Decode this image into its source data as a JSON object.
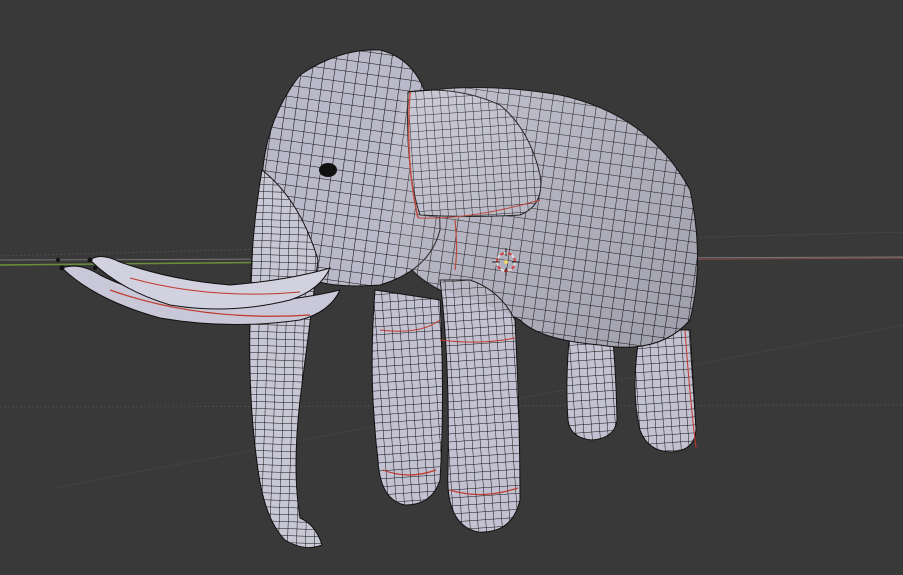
{
  "viewport": {
    "background": "#393939",
    "grid_line_color": "#4a4a4a",
    "mode": "edit-mode-wireframe-overlay",
    "shading": "solid"
  },
  "model": {
    "object": "elephant-mesh",
    "surface_color": "#b9b8c8",
    "wire_color": "#111111",
    "seam_color": "#c0392b"
  },
  "axes": {
    "x_axis_color": "#9b3b3b",
    "y_axis_color": "#6a8f3a"
  },
  "cursor": {
    "icon": "3d-cursor-icon",
    "ring_color_a": "#e0e0e0",
    "ring_color_b": "#d04040"
  }
}
